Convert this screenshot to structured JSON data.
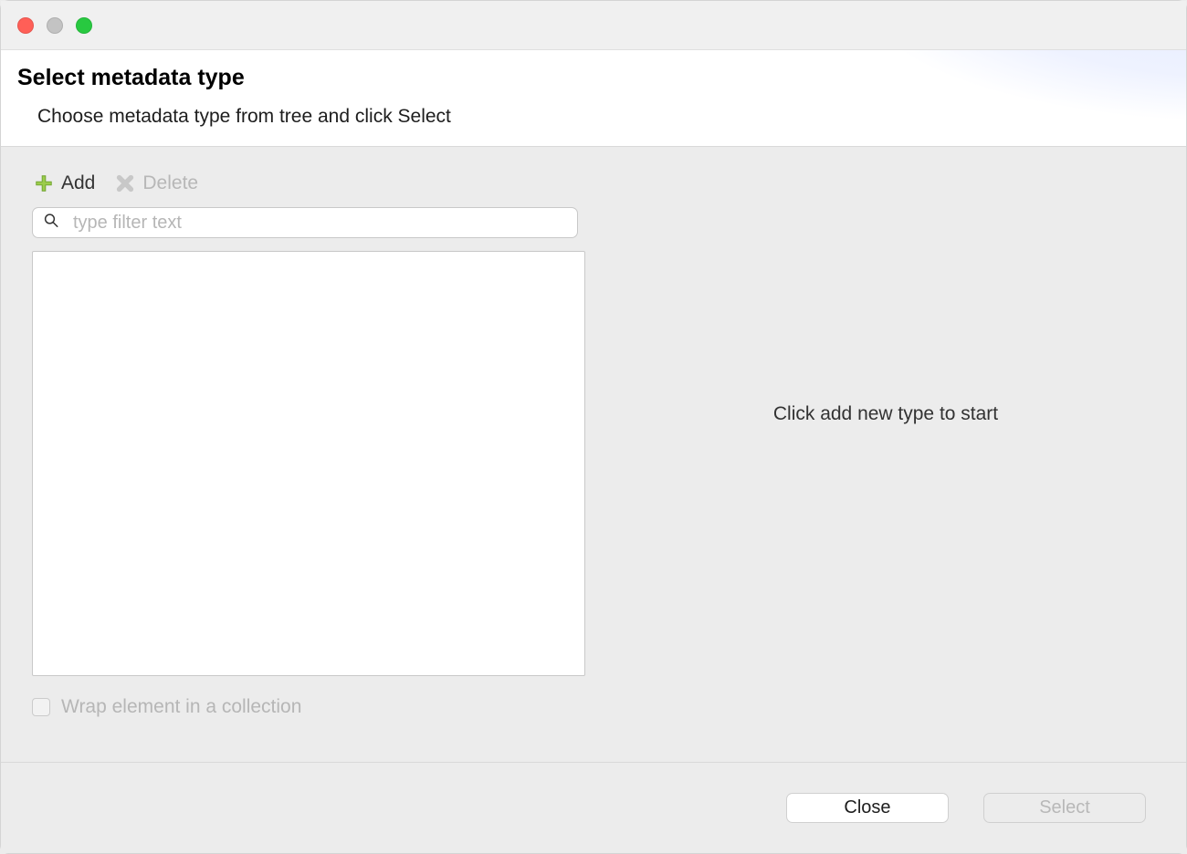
{
  "header": {
    "title": "Select metadata type",
    "subtitle": "Choose metadata type from tree and click Select"
  },
  "toolbar": {
    "add_label": "Add",
    "delete_label": "Delete"
  },
  "search": {
    "placeholder": "type filter text",
    "value": ""
  },
  "wrap_checkbox": {
    "label": "Wrap element in a collection",
    "checked": false
  },
  "hint": {
    "empty_state": "Click add new type to start"
  },
  "footer": {
    "close_label": "Close",
    "select_label": "Select"
  }
}
